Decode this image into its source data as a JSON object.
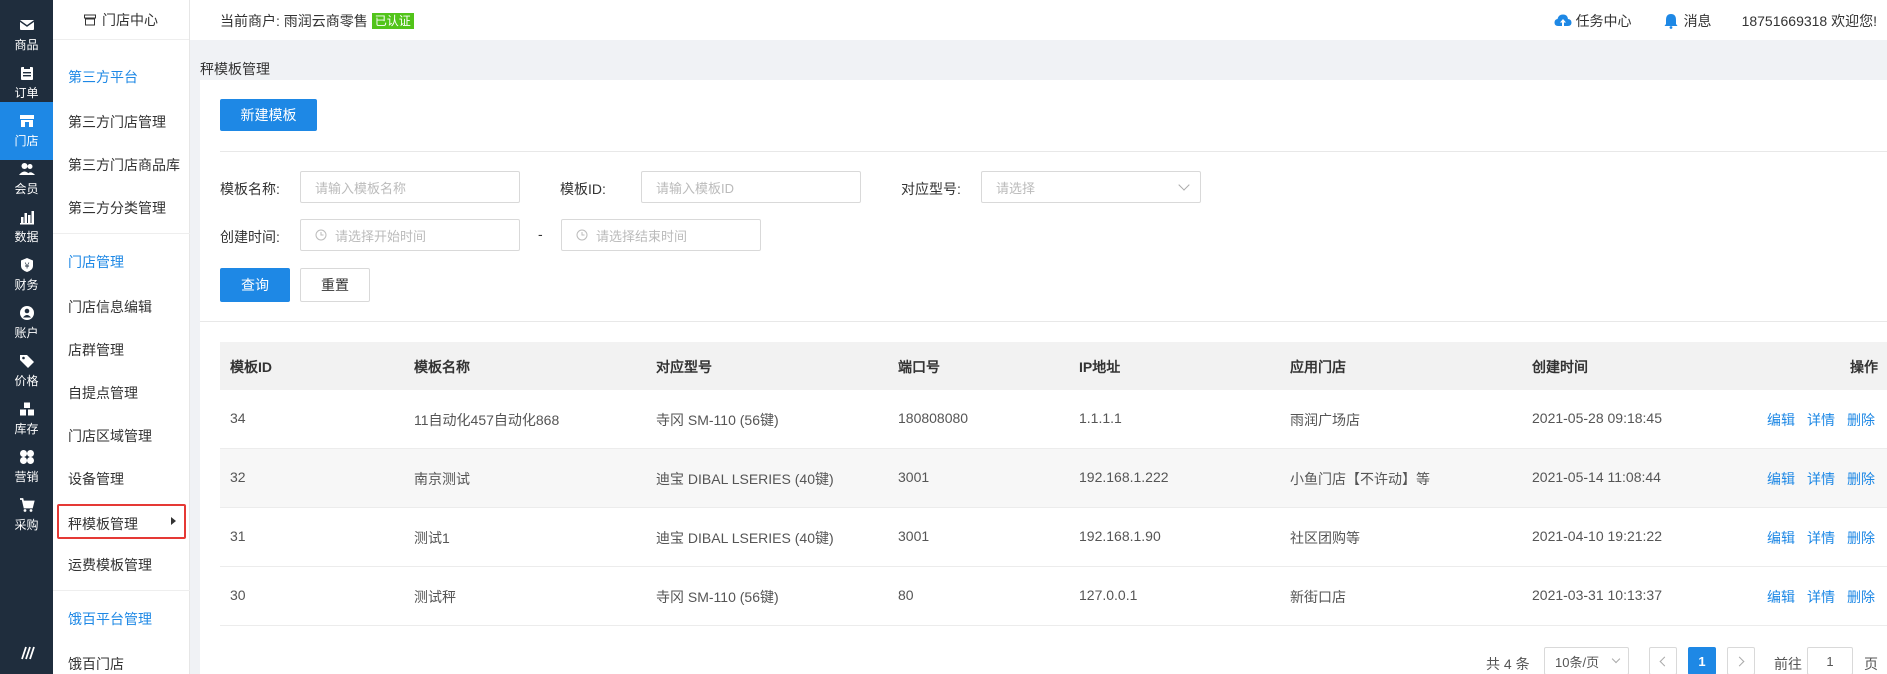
{
  "rail": [
    {
      "label": "商品",
      "icon": "mail-icon"
    },
    {
      "label": "订单",
      "icon": "clipboard-icon"
    },
    {
      "label": "门店",
      "icon": "store-icon"
    },
    {
      "label": "会员",
      "icon": "users-icon"
    },
    {
      "label": "数据",
      "icon": "bar-chart-icon"
    },
    {
      "label": "财务",
      "icon": "finance-icon"
    },
    {
      "label": "账户",
      "icon": "account-icon"
    },
    {
      "label": "价格",
      "icon": "price-tag-icon"
    },
    {
      "label": "库存",
      "icon": "stock-icon"
    },
    {
      "label": "营销",
      "icon": "marketing-icon"
    },
    {
      "label": "采购",
      "icon": "cart-icon"
    }
  ],
  "sidebar": {
    "title": "门店中心",
    "groups": [
      {
        "title": "第三方平台",
        "items": [
          "第三方门店管理",
          "第三方门店商品库",
          "第三方分类管理"
        ]
      },
      {
        "title": "门店管理",
        "items": [
          "门店信息编辑",
          "店群管理",
          "自提点管理",
          "门店区域管理",
          "设备管理",
          "秤模板管理",
          "运费模板管理"
        ]
      },
      {
        "title": "饿百平台管理",
        "items": [
          "饿百门店"
        ]
      }
    ]
  },
  "topbar": {
    "merchant_label": "当前商户: 雨润云商零售",
    "verified": "已认证",
    "task_center": "任务中心",
    "messages": "消息",
    "welcome": "18751669318 欢迎您!"
  },
  "breadcrumb": "秤模板管理",
  "toolbar": {
    "new_template": "新建模板"
  },
  "filters": {
    "name_label": "模板名称:",
    "name_placeholder": "请输入模板名称",
    "id_label": "模板ID:",
    "id_placeholder": "请输入模板ID",
    "model_label": "对应型号:",
    "model_placeholder": "请选择",
    "created_label": "创建时间:",
    "start_placeholder": "请选择开始时间",
    "range_sep": "-",
    "end_placeholder": "请选择结束时间",
    "query": "查询",
    "reset": "重置"
  },
  "table": {
    "columns": [
      "模板ID",
      "模板名称",
      "对应型号",
      "端口号",
      "IP地址",
      "应用门店",
      "创建时间",
      "操作"
    ],
    "actions": [
      "编辑",
      "详情",
      "删除"
    ],
    "rows": [
      {
        "id": "34",
        "name": "11自动化457自动化868",
        "model": "寺冈 SM-110 (56键)",
        "port": "180808080",
        "ip": "1.1.1.1",
        "store": "雨润广场店",
        "created": "2021-05-28 09:18:45"
      },
      {
        "id": "32",
        "name": "南京测试",
        "model": "迪宝 DIBAL LSERIES (40键)",
        "port": "3001",
        "ip": "192.168.1.222",
        "store": "小鱼门店【不许动】等",
        "created": "2021-05-14 11:08:44"
      },
      {
        "id": "31",
        "name": "测试1",
        "model": "迪宝 DIBAL LSERIES (40键)",
        "port": "3001",
        "ip": "192.168.1.90",
        "store": "社区团购等",
        "created": "2021-04-10 19:21:22"
      },
      {
        "id": "30",
        "name": "测试秤",
        "model": "寺冈 SM-110 (56键)",
        "port": "80",
        "ip": "127.0.0.1",
        "store": "新街口店",
        "created": "2021-03-31 10:13:37"
      }
    ]
  },
  "pagination": {
    "total": "共 4 条",
    "page_size": "10条/页",
    "current": "1",
    "goto_label": "前往",
    "goto_value": "1",
    "page_suffix": "页"
  },
  "colors": {
    "accent": "#1e88e5",
    "rail_bg": "#1f2d3d",
    "verified": "#52c41a",
    "highlight_border": "#e53935"
  }
}
